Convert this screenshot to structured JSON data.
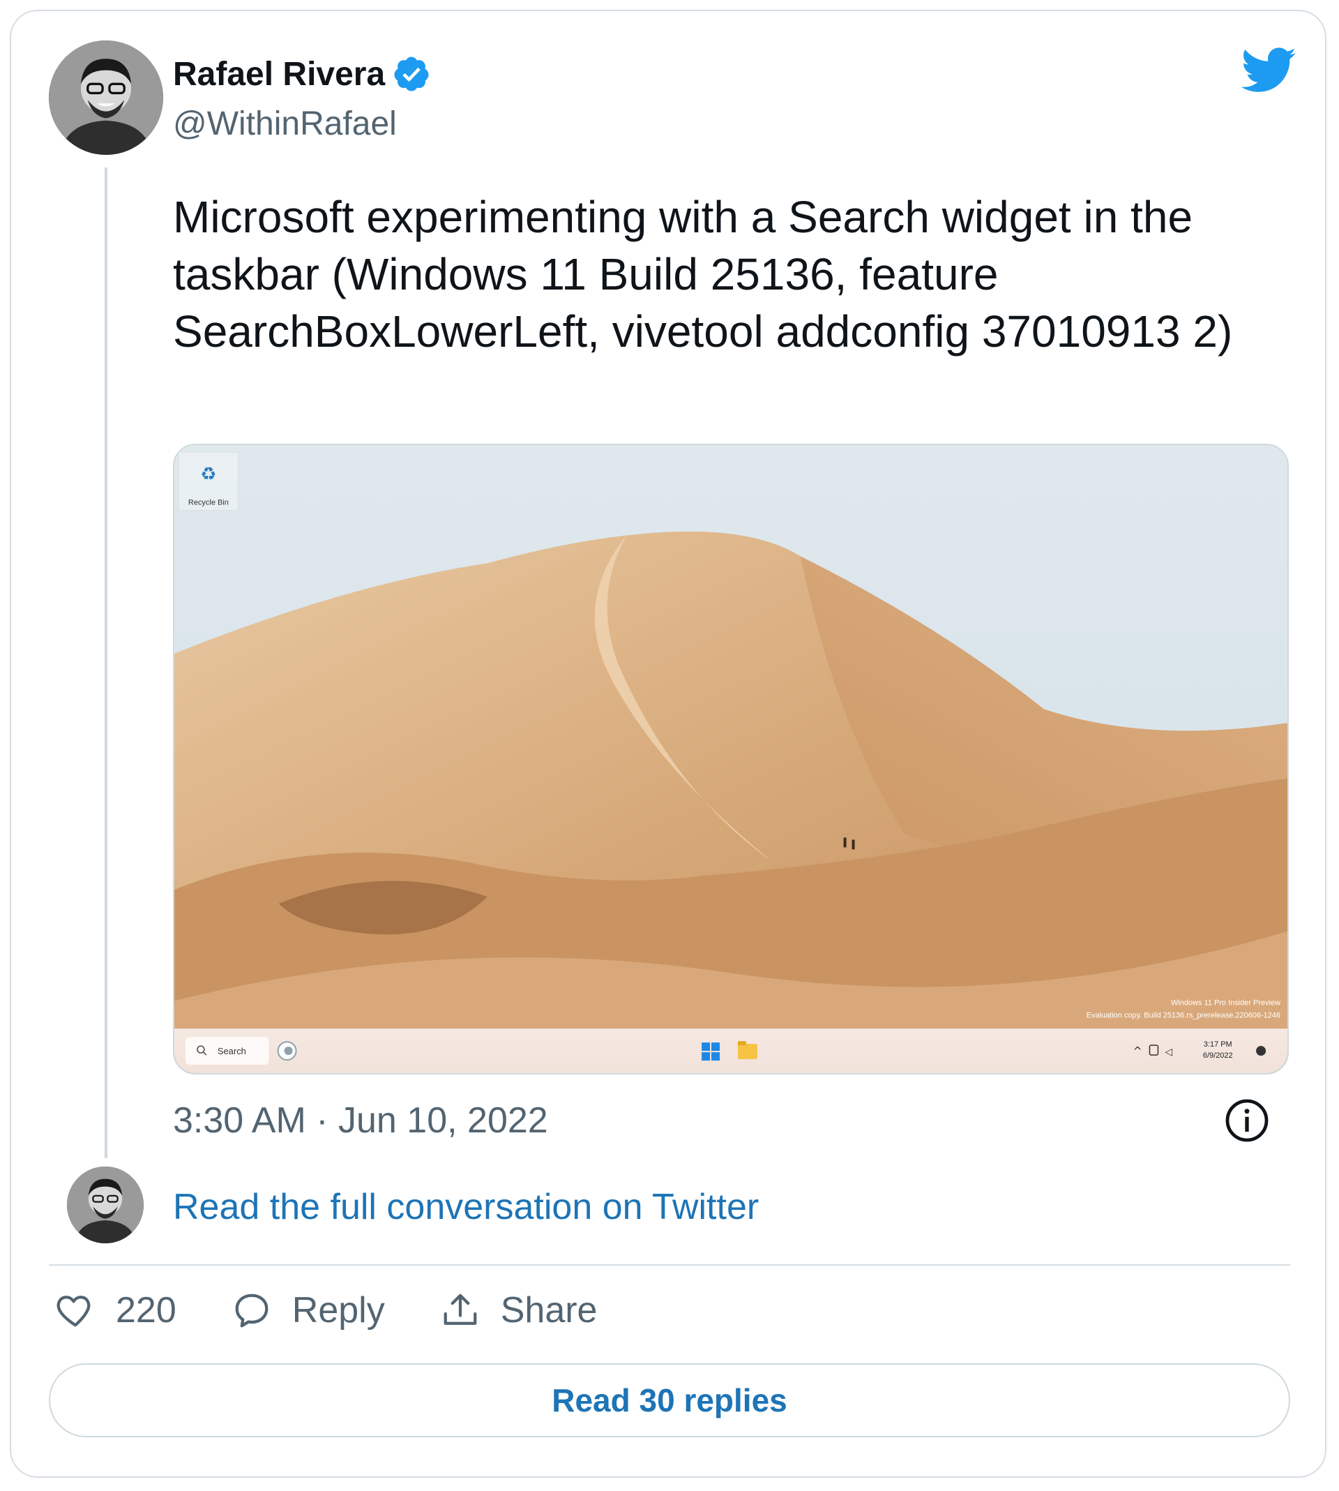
{
  "author": {
    "name": "Rafael Rivera",
    "handle": "@WithinRafael",
    "verified": true
  },
  "tweet": {
    "text": "Microsoft experimenting with a Search widget in the taskbar (Windows 11 Build 25136, feature SearchBoxLowerLeft, vivetool addconfig 37010913 2)",
    "timestamp": "3:30 AM · Jun 10, 2022"
  },
  "media": {
    "desktop_icon_label": "Recycle Bin",
    "watermark_line1": "Windows 11 Pro Insider Preview",
    "watermark_line2": "Evaluation copy. Build 25136.rs_prerelease.220606-1246",
    "taskbar": {
      "search_label": "Search",
      "clock_time": "3:17 PM",
      "clock_date": "6/9/2022"
    }
  },
  "conversation_link": "Read the full conversation on Twitter",
  "actions": {
    "likes_count": "220",
    "reply_label": "Reply",
    "share_label": "Share"
  },
  "read_replies_label": "Read 30 replies",
  "colors": {
    "link": "#1d74b6",
    "twitter_brand": "#1d9bf0",
    "secondary_text": "#536471"
  }
}
